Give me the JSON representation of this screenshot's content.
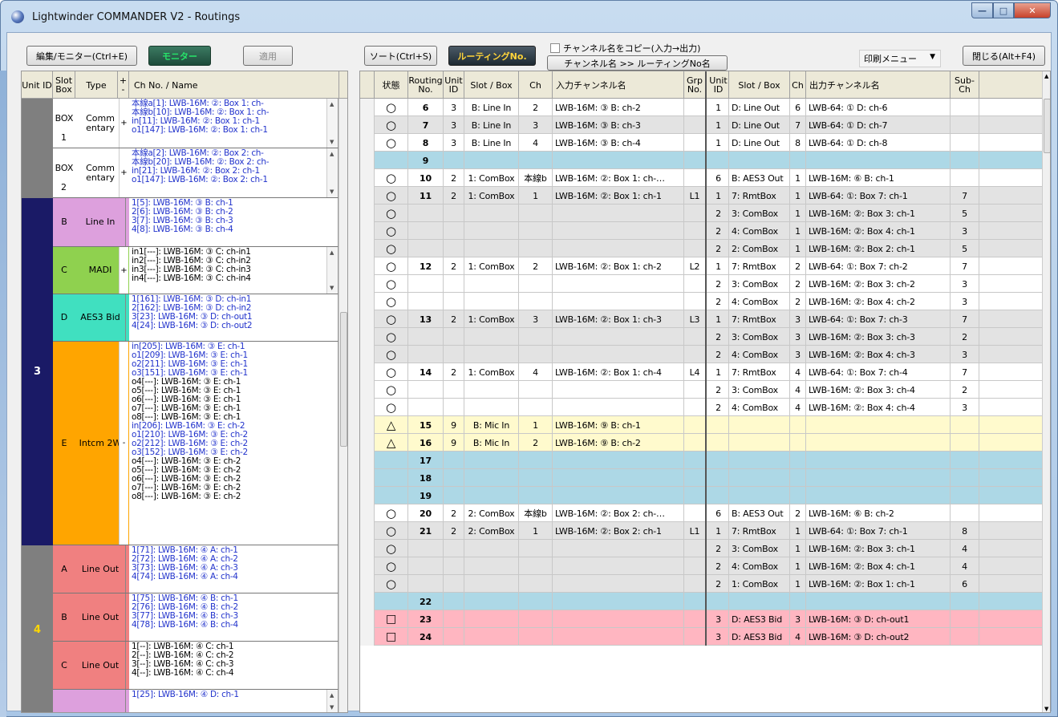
{
  "window": {
    "title": "Lightwinder COMMANDER V2 - Routings"
  },
  "toolbar": {
    "edit_monitor": "編集/モニター(Ctrl+E)",
    "monitor": "モニター",
    "apply": "適用",
    "sort": "ソート(Ctrl+S)",
    "routing_no": "ルーティングNo.",
    "copy_names": "チャンネル名をコピー(入力→出力)",
    "name_to_routing": "チャンネル名 >> ルーティングNo名",
    "print_menu": "印刷メニュー",
    "close": "閉じる(Alt+F4)"
  },
  "left_header": {
    "unit": "Unit ID",
    "slot": "Slot Box",
    "type": "Type",
    "pm": "+ -",
    "ch": "Ch No. / Name"
  },
  "left_groups": [
    {
      "unit": "",
      "unit_bg": "#7f7f7f",
      "unit_color": "#ffffff",
      "slots": [
        {
          "key": "BOX",
          "name": "Comm entary",
          "num": "1",
          "bg": "#ffffff",
          "pm": "+",
          "lines": [
            {
              "t": "本線a[1]: LWB-16M: ②: Box 1: ch-",
              "c": "blue"
            },
            {
              "t": "本線b[10]: LWB-16M: ②: Box 1: ch-",
              "c": "blue"
            },
            {
              "t": "in[11]: LWB-16M: ②: Box 1: ch-1",
              "c": "blue"
            },
            {
              "t": "o1[147]: LWB-16M: ②: Box 1: ch-1",
              "c": "blue"
            }
          ],
          "h": 62,
          "scroll": true
        },
        {
          "key": "BOX",
          "name": "Comm entary",
          "num": "2",
          "bg": "#ffffff",
          "pm": "+",
          "lines": [
            {
              "t": "本線a[2]: LWB-16M: ②: Box 2: ch-",
              "c": "blue"
            },
            {
              "t": "本線b[20]: LWB-16M: ②: Box 2: ch-",
              "c": "blue"
            },
            {
              "t": "in[21]: LWB-16M: ②: Box 2: ch-1",
              "c": "blue"
            },
            {
              "t": "o1[147]: LWB-16M: ②: Box 2: ch-1",
              "c": "blue"
            }
          ],
          "h": 62,
          "scroll": true
        }
      ]
    },
    {
      "unit": "3",
      "unit_bg": "#1a1a66",
      "unit_color": "#ffffff",
      "slots": [
        {
          "key": "B",
          "name": "Line In",
          "bg": "#dda0dd",
          "pm": "",
          "lines": [
            {
              "t": "1[5]: LWB-16M: ③ B: ch-1",
              "c": "blue"
            },
            {
              "t": "2[6]: LWB-16M: ③ B: ch-2",
              "c": "blue"
            },
            {
              "t": "3[7]: LWB-16M: ③ B: ch-3",
              "c": "blue"
            },
            {
              "t": "4[8]: LWB-16M: ③ B: ch-4",
              "c": "blue"
            }
          ],
          "h": 61,
          "scroll": false
        },
        {
          "key": "C",
          "name": "MADI",
          "bg": "#8fd14f",
          "pm": "+",
          "lines": [
            {
              "t": "in1[---]: LWB-16M: ③ C: ch-in1",
              "c": "black"
            },
            {
              "t": "in2[---]: LWB-16M: ③ C: ch-in2",
              "c": "black"
            },
            {
              "t": "in3[---]: LWB-16M: ③ C: ch-in3",
              "c": "black"
            },
            {
              "t": "in4[---]: LWB-16M: ③ C: ch-in4",
              "c": "black"
            }
          ],
          "h": 59,
          "scroll": true
        },
        {
          "key": "D",
          "name": "AES3 Bid",
          "bg": "#40e0c0",
          "pm": "",
          "lines": [
            {
              "t": "1[161]: LWB-16M: ③ D: ch-in1",
              "c": "blue"
            },
            {
              "t": "2[162]: LWB-16M: ③ D: ch-in2",
              "c": "blue"
            },
            {
              "t": "3[23]: LWB-16M: ③ D: ch-out1",
              "c": "blue"
            },
            {
              "t": "4[24]: LWB-16M: ③ D: ch-out2",
              "c": "blue"
            }
          ],
          "h": 59,
          "scroll": false
        },
        {
          "key": "E",
          "name": "Intcm 2W",
          "bg": "#ffa500",
          "pm": "-",
          "lines": [
            {
              "t": "in[205]: LWB-16M: ③ E: ch-1",
              "c": "blue"
            },
            {
              "t": "o1[209]: LWB-16M: ③ E: ch-1",
              "c": "blue"
            },
            {
              "t": "o2[211]: LWB-16M: ③ E: ch-1",
              "c": "blue"
            },
            {
              "t": "o3[151]: LWB-16M: ③ E: ch-1",
              "c": "blue"
            },
            {
              "t": "o4[---]: LWB-16M: ③ E: ch-1",
              "c": "black"
            },
            {
              "t": "o5[---]: LWB-16M: ③ E: ch-1",
              "c": "black"
            },
            {
              "t": "o6[---]: LWB-16M: ③ E: ch-1",
              "c": "black"
            },
            {
              "t": "o7[---]: LWB-16M: ③ E: ch-1",
              "c": "black"
            },
            {
              "t": "o8[---]: LWB-16M: ③ E: ch-1",
              "c": "black"
            },
            {
              "t": "in[206]: LWB-16M: ③ E: ch-2",
              "c": "blue"
            },
            {
              "t": "o1[210]: LWB-16M: ③ E: ch-2",
              "c": "blue"
            },
            {
              "t": "o2[212]: LWB-16M: ③ E: ch-2",
              "c": "blue"
            },
            {
              "t": "o3[152]: LWB-16M: ③ E: ch-2",
              "c": "blue"
            },
            {
              "t": "o4[---]: LWB-16M: ③ E: ch-2",
              "c": "black"
            },
            {
              "t": "o5[---]: LWB-16M: ③ E: ch-2",
              "c": "black"
            },
            {
              "t": "o6[---]: LWB-16M: ③ E: ch-2",
              "c": "black"
            },
            {
              "t": "o7[---]: LWB-16M: ③ E: ch-2",
              "c": "black"
            },
            {
              "t": "o8[---]: LWB-16M: ③ E: ch-2",
              "c": "black"
            }
          ],
          "h": 254,
          "scroll": false
        }
      ]
    },
    {
      "unit": "4",
      "unit_bg": "#7f7f7f",
      "unit_color": "#ffd700",
      "slots": [
        {
          "key": "A",
          "name": "Line Out",
          "bg": "#f08080",
          "pm": "",
          "lines": [
            {
              "t": "1[71]: LWB-16M: ④ A: ch-1",
              "c": "blue"
            },
            {
              "t": "2[72]: LWB-16M: ④ A: ch-2",
              "c": "blue"
            },
            {
              "t": "3[73]: LWB-16M: ④ A: ch-3",
              "c": "blue"
            },
            {
              "t": "4[74]: LWB-16M: ④ A: ch-4",
              "c": "blue"
            }
          ],
          "h": 60,
          "scroll": false
        },
        {
          "key": "B",
          "name": "Line Out",
          "bg": "#f08080",
          "pm": "",
          "lines": [
            {
              "t": "1[75]: LWB-16M: ④ B: ch-1",
              "c": "blue"
            },
            {
              "t": "2[76]: LWB-16M: ④ B: ch-2",
              "c": "blue"
            },
            {
              "t": "3[77]: LWB-16M: ④ B: ch-3",
              "c": "blue"
            },
            {
              "t": "4[78]: LWB-16M: ④ B: ch-4",
              "c": "blue"
            }
          ],
          "h": 60,
          "scroll": false
        },
        {
          "key": "C",
          "name": "Line Out",
          "bg": "#f08080",
          "pm": "",
          "lines": [
            {
              "t": "1[--]: LWB-16M: ④ C: ch-1",
              "c": "black"
            },
            {
              "t": "2[--]: LWB-16M: ④ C: ch-2",
              "c": "black"
            },
            {
              "t": "3[--]: LWB-16M: ④ C: ch-3",
              "c": "black"
            },
            {
              "t": "4[--]: LWB-16M: ④ C: ch-4",
              "c": "black"
            }
          ],
          "h": 60,
          "scroll": false
        },
        {
          "key": "",
          "name": "",
          "bg": "#dda0dd",
          "pm": "",
          "lines": [
            {
              "t": "1[25]: LWB-16M: ④ D: ch-1",
              "c": "blue"
            }
          ],
          "h": 30,
          "scroll": true
        }
      ]
    }
  ],
  "right_header": {
    "status": "状態",
    "routing": "Routing No.",
    "unit_in": "Unit ID",
    "slot_in": "Slot / Box",
    "ch_in": "Ch",
    "in_name": "入力チャンネル名",
    "grp": "Grp No.",
    "unit_out": "Unit ID",
    "slot_out": "Slot / Box",
    "ch_out": "Ch",
    "out_name": "出力チャンネル名",
    "sub": "Sub- Ch"
  },
  "colors": {
    "blank": "#add8e6",
    "gray": "#e3e3e3",
    "white": "#ffffff",
    "yellow": "#fffacd",
    "pink": "#ffb6c1"
  },
  "routes": [
    {
      "st": "○",
      "no": "6",
      "u": "3",
      "sl": "B: Line In",
      "ch": "2",
      "inn": "LWB-16M: ③ B: ch-2",
      "grp": "",
      "uo": "1",
      "so": "D: Line Out",
      "co": "6",
      "outn": "LWB-64: ① D: ch-6",
      "sub": "",
      "bg": "white"
    },
    {
      "st": "○",
      "no": "7",
      "u": "3",
      "sl": "B: Line In",
      "ch": "3",
      "inn": "LWB-16M: ③ B: ch-3",
      "grp": "",
      "uo": "1",
      "so": "D: Line Out",
      "co": "7",
      "outn": "LWB-64: ① D: ch-7",
      "sub": "",
      "bg": "gray"
    },
    {
      "st": "○",
      "no": "8",
      "u": "3",
      "sl": "B: Line In",
      "ch": "4",
      "inn": "LWB-16M: ③ B: ch-4",
      "grp": "",
      "uo": "1",
      "so": "D: Line Out",
      "co": "8",
      "outn": "LWB-64: ① D: ch-8",
      "sub": "",
      "bg": "white"
    },
    {
      "st": "",
      "no": "9",
      "u": "",
      "sl": "",
      "ch": "",
      "inn": "",
      "grp": "",
      "uo": "",
      "so": "",
      "co": "",
      "outn": "",
      "sub": "",
      "bg": "blank"
    },
    {
      "st": "○",
      "no": "10",
      "u": "2",
      "sl": "1: ComBox",
      "ch": "本線b",
      "inn": "LWB-16M: ②: Box 1: ch-…",
      "grp": "",
      "uo": "6",
      "so": "B: AES3 Out",
      "co": "1",
      "outn": "LWB-16M: ⑥ B: ch-1",
      "sub": "",
      "bg": "white"
    },
    {
      "st": "○",
      "no": "11",
      "u": "2",
      "sl": "1: ComBox",
      "ch": "1",
      "inn": "LWB-16M: ②: Box 1: ch-1",
      "grp": "L1",
      "uo": "1",
      "so": "7: RmtBox",
      "co": "1",
      "outn": "LWB-64: ①: Box 7: ch-1",
      "sub": "7",
      "bg": "gray"
    },
    {
      "st": "○",
      "no": "",
      "u": "",
      "sl": "",
      "ch": "",
      "inn": "",
      "grp": "",
      "uo": "2",
      "so": "3: ComBox",
      "co": "1",
      "outn": "LWB-16M: ②: Box 3: ch-1",
      "sub": "5",
      "bg": "gray"
    },
    {
      "st": "○",
      "no": "",
      "u": "",
      "sl": "",
      "ch": "",
      "inn": "",
      "grp": "",
      "uo": "2",
      "so": "4: ComBox",
      "co": "1",
      "outn": "LWB-16M: ②: Box 4: ch-1",
      "sub": "3",
      "bg": "gray"
    },
    {
      "st": "○",
      "no": "",
      "u": "",
      "sl": "",
      "ch": "",
      "inn": "",
      "grp": "",
      "uo": "2",
      "so": "2: ComBox",
      "co": "1",
      "outn": "LWB-16M: ②: Box 2: ch-1",
      "sub": "5",
      "bg": "gray"
    },
    {
      "st": "○",
      "no": "12",
      "u": "2",
      "sl": "1: ComBox",
      "ch": "2",
      "inn": "LWB-16M: ②: Box 1: ch-2",
      "grp": "L2",
      "uo": "1",
      "so": "7: RmtBox",
      "co": "2",
      "outn": "LWB-64: ①: Box 7: ch-2",
      "sub": "7",
      "bg": "white"
    },
    {
      "st": "○",
      "no": "",
      "u": "",
      "sl": "",
      "ch": "",
      "inn": "",
      "grp": "",
      "uo": "2",
      "so": "3: ComBox",
      "co": "2",
      "outn": "LWB-16M: ②: Box 3: ch-2",
      "sub": "3",
      "bg": "white"
    },
    {
      "st": "○",
      "no": "",
      "u": "",
      "sl": "",
      "ch": "",
      "inn": "",
      "grp": "",
      "uo": "2",
      "so": "4: ComBox",
      "co": "2",
      "outn": "LWB-16M: ②: Box 4: ch-2",
      "sub": "3",
      "bg": "white"
    },
    {
      "st": "○",
      "no": "13",
      "u": "2",
      "sl": "1: ComBox",
      "ch": "3",
      "inn": "LWB-16M: ②: Box 1: ch-3",
      "grp": "L3",
      "uo": "1",
      "so": "7: RmtBox",
      "co": "3",
      "outn": "LWB-64: ①: Box 7: ch-3",
      "sub": "7",
      "bg": "gray"
    },
    {
      "st": "○",
      "no": "",
      "u": "",
      "sl": "",
      "ch": "",
      "inn": "",
      "grp": "",
      "uo": "2",
      "so": "3: ComBox",
      "co": "3",
      "outn": "LWB-16M: ②: Box 3: ch-3",
      "sub": "2",
      "bg": "gray"
    },
    {
      "st": "○",
      "no": "",
      "u": "",
      "sl": "",
      "ch": "",
      "inn": "",
      "grp": "",
      "uo": "2",
      "so": "4: ComBox",
      "co": "3",
      "outn": "LWB-16M: ②: Box 4: ch-3",
      "sub": "3",
      "bg": "gray"
    },
    {
      "st": "○",
      "no": "14",
      "u": "2",
      "sl": "1: ComBox",
      "ch": "4",
      "inn": "LWB-16M: ②: Box 1: ch-4",
      "grp": "L4",
      "uo": "1",
      "so": "7: RmtBox",
      "co": "4",
      "outn": "LWB-64: ①: Box 7: ch-4",
      "sub": "7",
      "bg": "white"
    },
    {
      "st": "○",
      "no": "",
      "u": "",
      "sl": "",
      "ch": "",
      "inn": "",
      "grp": "",
      "uo": "2",
      "so": "3: ComBox",
      "co": "4",
      "outn": "LWB-16M: ②: Box 3: ch-4",
      "sub": "2",
      "bg": "white"
    },
    {
      "st": "○",
      "no": "",
      "u": "",
      "sl": "",
      "ch": "",
      "inn": "",
      "grp": "",
      "uo": "2",
      "so": "4: ComBox",
      "co": "4",
      "outn": "LWB-16M: ②: Box 4: ch-4",
      "sub": "3",
      "bg": "white"
    },
    {
      "st": "△",
      "no": "15",
      "u": "9",
      "sl": "B: Mic In",
      "ch": "1",
      "inn": "LWB-16M: ⑨ B: ch-1",
      "grp": "",
      "uo": "",
      "so": "",
      "co": "",
      "outn": "",
      "sub": "",
      "bg": "yellow"
    },
    {
      "st": "△",
      "no": "16",
      "u": "9",
      "sl": "B: Mic In",
      "ch": "2",
      "inn": "LWB-16M: ⑨ B: ch-2",
      "grp": "",
      "uo": "",
      "so": "",
      "co": "",
      "outn": "",
      "sub": "",
      "bg": "yellow"
    },
    {
      "st": "",
      "no": "17",
      "u": "",
      "sl": "",
      "ch": "",
      "inn": "",
      "grp": "",
      "uo": "",
      "so": "",
      "co": "",
      "outn": "",
      "sub": "",
      "bg": "blank"
    },
    {
      "st": "",
      "no": "18",
      "u": "",
      "sl": "",
      "ch": "",
      "inn": "",
      "grp": "",
      "uo": "",
      "so": "",
      "co": "",
      "outn": "",
      "sub": "",
      "bg": "blank"
    },
    {
      "st": "",
      "no": "19",
      "u": "",
      "sl": "",
      "ch": "",
      "inn": "",
      "grp": "",
      "uo": "",
      "so": "",
      "co": "",
      "outn": "",
      "sub": "",
      "bg": "blank"
    },
    {
      "st": "○",
      "no": "20",
      "u": "2",
      "sl": "2: ComBox",
      "ch": "本線b",
      "inn": "LWB-16M: ②: Box 2: ch-…",
      "grp": "",
      "uo": "6",
      "so": "B: AES3 Out",
      "co": "2",
      "outn": "LWB-16M: ⑥ B: ch-2",
      "sub": "",
      "bg": "white"
    },
    {
      "st": "○",
      "no": "21",
      "u": "2",
      "sl": "2: ComBox",
      "ch": "1",
      "inn": "LWB-16M: ②: Box 2: ch-1",
      "grp": "L1",
      "uo": "1",
      "so": "7: RmtBox",
      "co": "1",
      "outn": "LWB-64: ①: Box 7: ch-1",
      "sub": "8",
      "bg": "gray"
    },
    {
      "st": "○",
      "no": "",
      "u": "",
      "sl": "",
      "ch": "",
      "inn": "",
      "grp": "",
      "uo": "2",
      "so": "3: ComBox",
      "co": "1",
      "outn": "LWB-16M: ②: Box 3: ch-1",
      "sub": "4",
      "bg": "gray"
    },
    {
      "st": "○",
      "no": "",
      "u": "",
      "sl": "",
      "ch": "",
      "inn": "",
      "grp": "",
      "uo": "2",
      "so": "4: ComBox",
      "co": "1",
      "outn": "LWB-16M: ②: Box 4: ch-1",
      "sub": "4",
      "bg": "gray"
    },
    {
      "st": "○",
      "no": "",
      "u": "",
      "sl": "",
      "ch": "",
      "inn": "",
      "grp": "",
      "uo": "2",
      "so": "1: ComBox",
      "co": "1",
      "outn": "LWB-16M: ②: Box 1: ch-1",
      "sub": "6",
      "bg": "gray"
    },
    {
      "st": "",
      "no": "22",
      "u": "",
      "sl": "",
      "ch": "",
      "inn": "",
      "grp": "",
      "uo": "",
      "so": "",
      "co": "",
      "outn": "",
      "sub": "",
      "bg": "blank"
    },
    {
      "st": "□",
      "no": "23",
      "u": "",
      "sl": "",
      "ch": "",
      "inn": "",
      "grp": "",
      "uo": "3",
      "so": "D: AES3 Bid",
      "co": "3",
      "outn": "LWB-16M: ③ D: ch-out1",
      "sub": "",
      "bg": "pink"
    },
    {
      "st": "□",
      "no": "24",
      "u": "",
      "sl": "",
      "ch": "",
      "inn": "",
      "grp": "",
      "uo": "3",
      "so": "D: AES3 Bid",
      "co": "4",
      "outn": "LWB-16M: ③ D: ch-out2",
      "sub": "",
      "bg": "pink"
    }
  ]
}
